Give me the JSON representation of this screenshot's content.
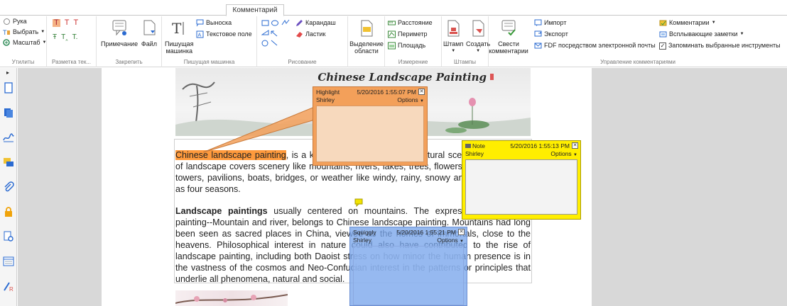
{
  "ribbon": {
    "active_tab": "Комментарий",
    "utilities": {
      "hand": "Рука",
      "select": "Выбрать",
      "zoom": "Масштаб",
      "label": "Утилиты"
    },
    "markup": {
      "label": "Разметка тек..."
    },
    "pin": {
      "note": "Примечание",
      "file": "Файл",
      "label": "Закрепить"
    },
    "typewriter": {
      "tool_line1": "Пишущая",
      "tool_line2": "машинка",
      "callout": "Выноска",
      "textbox": "Текстовое поле",
      "label": "Пишущая машинка"
    },
    "drawing": {
      "pencil": "Карандаш",
      "eraser": "Ластик",
      "label": "Рисование"
    },
    "area": {
      "line1": "Выделение",
      "line2": "области"
    },
    "measure": {
      "distance": "Расстояние",
      "perimeter": "Периметр",
      "area": "Площадь",
      "label": "Измерение"
    },
    "stamps": {
      "stamp": "Штамп",
      "create": "Создать",
      "label": "Штампы"
    },
    "summarize": {
      "line1": "Свести",
      "line2": "комментарии"
    },
    "manage": {
      "import": "Импорт",
      "export": "Экспорт",
      "fdf_email": "FDF посредством электронной почты",
      "label": "Управление комментариями"
    },
    "right": {
      "comments": "Комментарии",
      "popup_notes": "Всплывающие заметки",
      "remember": "Запоминать выбранные инструменты"
    }
  },
  "document": {
    "banner_title": "Chinese Landscape Painting",
    "para1_hl": "Chinese landscape painting",
    "para1_rest": ", is a kind of painting describing natural scenery. The subject of landscape covers scenery like mountains, rivers, lakes, trees, flowers, stones, houses, towers, pavilions, boats, bridges, or weather like windy, rainy, snowy and cloudy, as well as four seasons.",
    "para2_bold": "Landscape paintings",
    "para2_rest": " usually centered on mountains. The expression of Chinese painting--Mountain and river, belongs to Chinese landscape painting. Mountains had long been seen as sacred places in China, viewed as the homes of immortals, close to the heavens. Philosophical interest in nature could also have contributed to the rise of landscape painting, including both Daoist stress on how minor the human presence is in the vastness of the cosmos and Neo-Confucian interest in the patterns or principles that underlie all phenomena, natural and social."
  },
  "comments": [
    {
      "type": "Highlight",
      "date": "5/20/2016 1:55:07 PM",
      "author": "Shirley",
      "options": "Options",
      "color": "#f3a05a"
    },
    {
      "type": "Note",
      "date": "5/20/2016 1:55:13 PM",
      "author": "Shirley",
      "options": "Options",
      "color": "#ffee00"
    },
    {
      "type": "Squiggly",
      "date": "5/20/2016 1:55:21 PM",
      "author": "Shirley",
      "options": "Options",
      "color": "#78a5eb"
    }
  ]
}
